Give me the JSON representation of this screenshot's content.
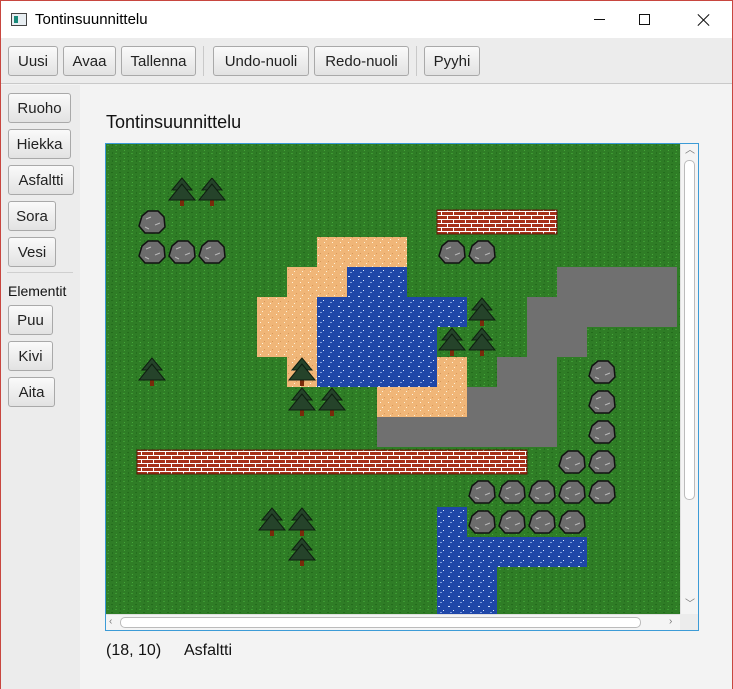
{
  "window": {
    "title": "Tontinsuunnittelu"
  },
  "toolbar": {
    "new_label": "Uusi",
    "open_label": "Avaa",
    "save_label": "Tallenna",
    "undo_label": "Undo-nuoli",
    "redo_label": "Redo-nuoli",
    "clear_label": "Pyyhi"
  },
  "sidebar": {
    "terrain": [
      "Ruoho",
      "Hiekka",
      "Asfaltti",
      "Sora",
      "Vesi"
    ],
    "elements_heading": "Elementit",
    "elements": [
      "Puu",
      "Kivi",
      "Aita"
    ]
  },
  "main": {
    "heading": "Tontinsuunnittelu"
  },
  "status": {
    "coords": "(18, 10)",
    "tile": "Asfaltti"
  },
  "colors": {
    "grass": "#2f7d26",
    "sand": "#f0b678",
    "water": "#1f47a8",
    "asphalt": "#707070",
    "fence": "#a6311a",
    "tree": "#25432a",
    "trunk": "#7a2a0a",
    "rock": "#6c6c6c",
    "accent": "#3c9bd6"
  },
  "map": {
    "grid": {
      "cols": 19,
      "rows": 15
    },
    "sand": [
      [
        7,
        3
      ],
      [
        8,
        3
      ],
      [
        9,
        3
      ],
      [
        6,
        4
      ],
      [
        7,
        4
      ],
      [
        5,
        5
      ],
      [
        6,
        5
      ],
      [
        5,
        6
      ],
      [
        6,
        6
      ],
      [
        6,
        7
      ],
      [
        11,
        7
      ],
      [
        9,
        8
      ],
      [
        10,
        8
      ],
      [
        11,
        8
      ]
    ],
    "water": [
      [
        8,
        4
      ],
      [
        9,
        4
      ],
      [
        7,
        5
      ],
      [
        8,
        5
      ],
      [
        9,
        5
      ],
      [
        10,
        5
      ],
      [
        11,
        5
      ],
      [
        7,
        6
      ],
      [
        8,
        6
      ],
      [
        9,
        6
      ],
      [
        10,
        6
      ],
      [
        7,
        7
      ],
      [
        8,
        7
      ],
      [
        9,
        7
      ],
      [
        10,
        7
      ],
      [
        11,
        12
      ],
      [
        11,
        13
      ],
      [
        12,
        13
      ],
      [
        13,
        13
      ],
      [
        14,
        13
      ],
      [
        15,
        13
      ],
      [
        11,
        14
      ],
      [
        12,
        14
      ],
      [
        11,
        15
      ],
      [
        12,
        15
      ]
    ],
    "asphalt": [
      [
        15,
        4
      ],
      [
        16,
        4
      ],
      [
        17,
        4
      ],
      [
        18,
        4
      ],
      [
        14,
        5
      ],
      [
        15,
        5
      ],
      [
        16,
        5
      ],
      [
        17,
        5
      ],
      [
        18,
        5
      ],
      [
        14,
        6
      ],
      [
        15,
        6
      ],
      [
        13,
        7
      ],
      [
        14,
        7
      ],
      [
        12,
        8
      ],
      [
        13,
        8
      ],
      [
        14,
        8
      ],
      [
        9,
        9
      ],
      [
        10,
        9
      ],
      [
        11,
        9
      ],
      [
        12,
        9
      ],
      [
        13,
        9
      ],
      [
        14,
        9
      ]
    ],
    "fences": [
      [
        11,
        2,
        4
      ],
      [
        1,
        10,
        13
      ]
    ],
    "trees": [
      [
        2,
        1
      ],
      [
        3,
        1
      ],
      [
        12,
        5
      ],
      [
        11,
        6
      ],
      [
        12,
        6
      ],
      [
        1,
        7
      ],
      [
        6,
        7
      ],
      [
        6,
        8
      ],
      [
        7,
        8
      ],
      [
        5,
        12
      ],
      [
        6,
        12
      ],
      [
        6,
        13
      ]
    ],
    "rocks": [
      [
        1,
        2
      ],
      [
        1,
        3
      ],
      [
        2,
        3
      ],
      [
        3,
        3
      ],
      [
        11,
        3
      ],
      [
        12,
        3
      ],
      [
        16,
        7
      ],
      [
        16,
        8
      ],
      [
        16,
        9
      ],
      [
        15,
        10
      ],
      [
        16,
        10
      ],
      [
        12,
        11
      ],
      [
        13,
        11
      ],
      [
        14,
        11
      ],
      [
        15,
        11
      ],
      [
        16,
        11
      ],
      [
        12,
        12
      ],
      [
        13,
        12
      ],
      [
        14,
        12
      ],
      [
        15,
        12
      ]
    ]
  }
}
